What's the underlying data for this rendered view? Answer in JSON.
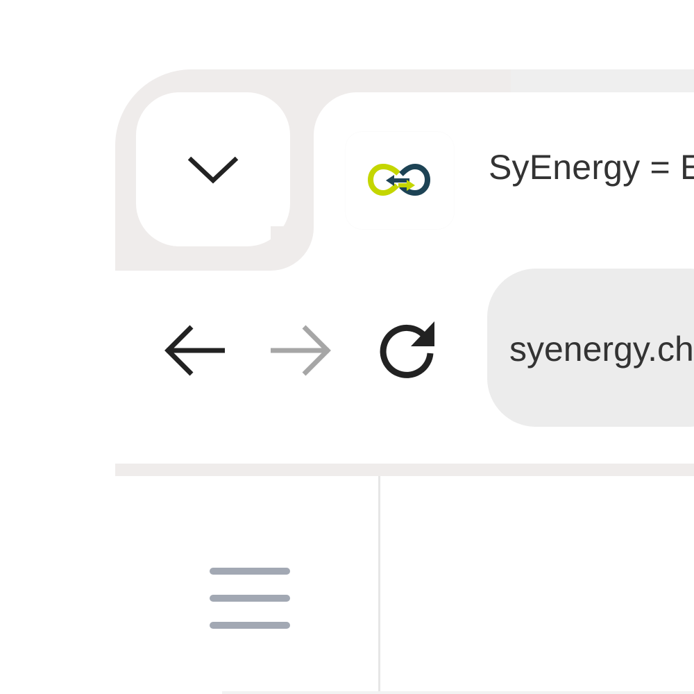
{
  "tab": {
    "title": "SyEnergy = E",
    "favicon": "syenergy-logo",
    "favicon_colors": {
      "lime": "#c4d600",
      "navy": "#1d4355"
    }
  },
  "toolbar": {
    "back_icon": "arrow-left-icon",
    "forward_icon": "arrow-right-icon",
    "reload_icon": "reload-icon",
    "forward_enabled": false
  },
  "omnibox": {
    "url": "syenergy.ch"
  },
  "page": {
    "menu_icon": "hamburger-menu-icon"
  },
  "colors": {
    "tabstrip": "#efeceb",
    "omnibox": "#ececec",
    "icon_active": "#222222",
    "icon_disabled": "#a6a6a6",
    "menu_icon": "#a2a8b3"
  }
}
